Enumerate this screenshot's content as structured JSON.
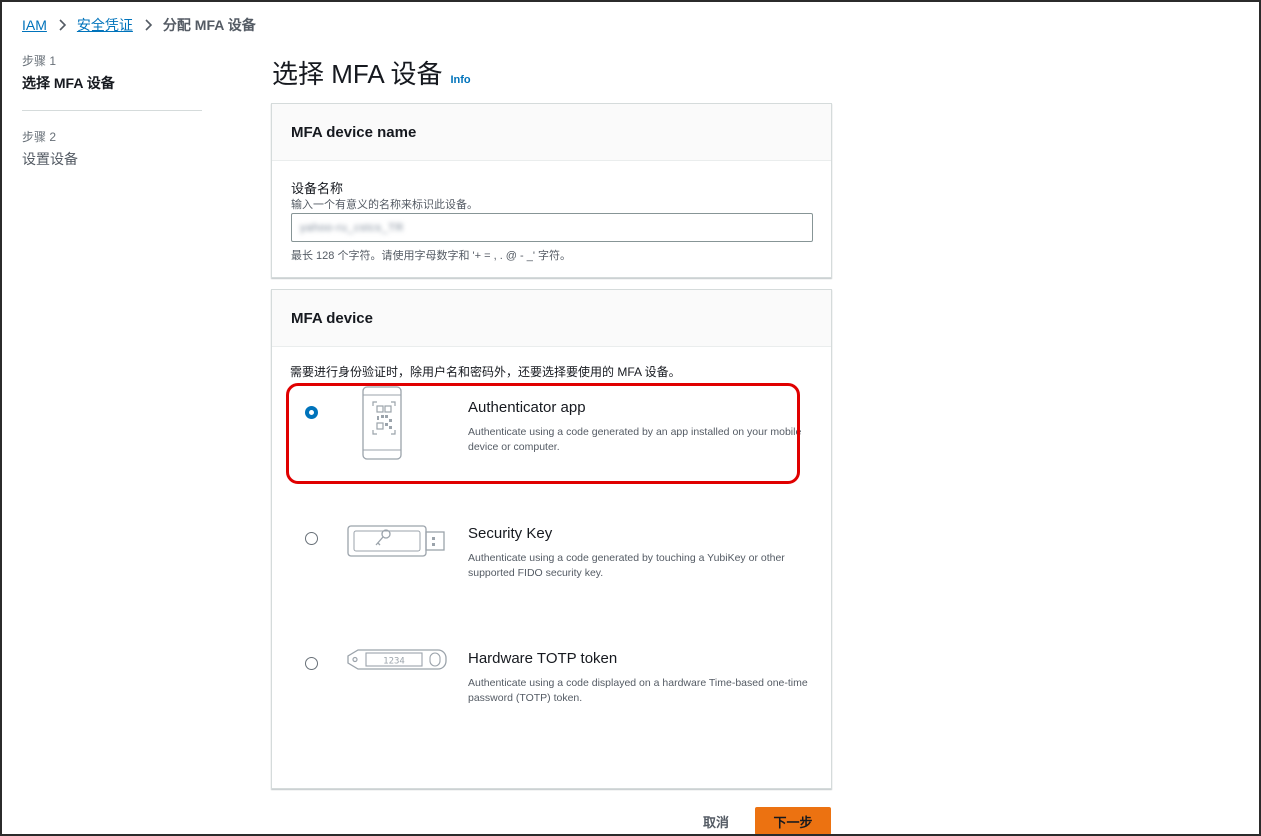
{
  "breadcrumb": {
    "items": [
      {
        "label": "IAM"
      },
      {
        "label": "安全凭证"
      }
    ],
    "current": "分配 MFA 设备"
  },
  "steps": [
    {
      "number": "步骤 1",
      "title": "选择 MFA 设备",
      "active": true
    },
    {
      "number": "步骤 2",
      "title": "设置设备",
      "active": false
    }
  ],
  "page": {
    "title": "选择 MFA 设备",
    "info_link": "Info"
  },
  "device_name_panel": {
    "header": "MFA device name",
    "field_label": "设备名称",
    "field_description": "输入一个有意义的名称来标识此设备。",
    "input_value": "yahoo-ru_cstcs_TR",
    "constraint": "最长 128 个字符。请使用字母数字和 '+ = , . @ - _' 字符。"
  },
  "device_panel": {
    "header": "MFA device",
    "intro": "需要进行身份验证时，除用户名和密码外，还要选择要使用的 MFA 设备。",
    "options": [
      {
        "title": "Authenticator app",
        "description": "Authenticate using a code generated by an app installed on your mobile device or computer.",
        "icon": "phone-qr-icon",
        "selected": true
      },
      {
        "title": "Security Key",
        "description": "Authenticate using a code generated by touching a YubiKey or other supported FIDO security key.",
        "icon": "usb-key-icon",
        "selected": false
      },
      {
        "title": "Hardware TOTP token",
        "description": "Authenticate using a code displayed on a hardware Time-based one-time password (TOTP) token.",
        "icon": "totp-token-icon",
        "token_display": "1234",
        "selected": false
      }
    ]
  },
  "footer": {
    "cancel_label": "取消",
    "next_label": "下一步"
  },
  "colors": {
    "link": "#0073bb",
    "primary_button": "#ec7211",
    "highlight": "#e00000",
    "radio_selected": "#0073bb"
  }
}
